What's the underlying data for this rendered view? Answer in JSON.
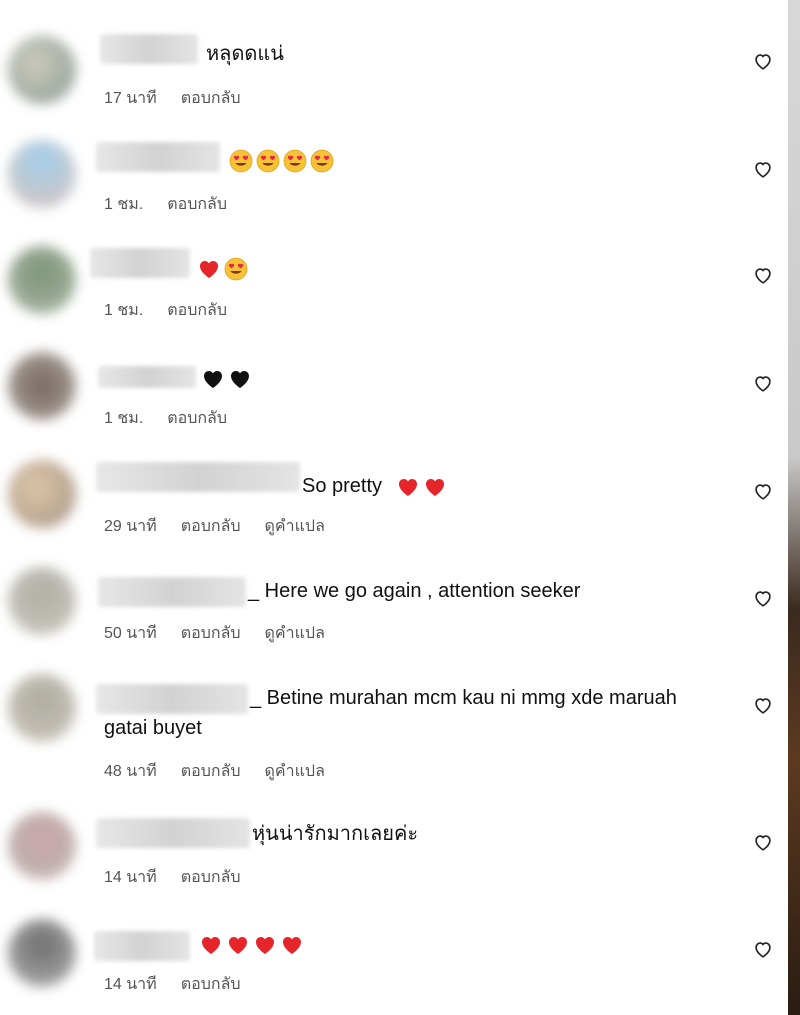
{
  "comments": [
    {
      "text": "หลุดดแน่",
      "time": "17 นาที",
      "reply": "ตอบกลับ",
      "emojis": []
    },
    {
      "text": "",
      "time": "1 ชม.",
      "reply": "ตอบกลับ",
      "emojis": [
        "heart-eyes",
        "heart-eyes",
        "heart-eyes",
        "heart-eyes"
      ]
    },
    {
      "text": "",
      "time": "1 ชม.",
      "reply": "ตอบกลับ",
      "emojis": [
        "red-heart",
        "heart-eyes"
      ]
    },
    {
      "text": "",
      "time": "1 ชม.",
      "reply": "ตอบกลับ",
      "emojis": [
        "black-heart",
        "black-heart"
      ]
    },
    {
      "text": "So pretty",
      "time": "29 นาที",
      "reply": "ตอบกลับ",
      "translate": "ดูคำแปล",
      "emojis": [
        "red-heart",
        "red-heart"
      ]
    },
    {
      "text": "_ Here we go again , attention seeker",
      "time": "50 นาที",
      "reply": "ตอบกลับ",
      "translate": "ดูคำแปล",
      "emojis": []
    },
    {
      "text": "_ Betine murahan mcm kau ni mmg xde maruah",
      "text2": "gatai buyet",
      "time": "48 นาที",
      "reply": "ตอบกลับ",
      "translate": "ดูคำแปล",
      "emojis": []
    },
    {
      "text": "หุ่นน่ารักมากเลยค่ะ",
      "time": "14 นาที",
      "reply": "ตอบกลับ",
      "emojis": []
    },
    {
      "text": "",
      "time": "14 นาที",
      "reply": "ตอบกลับ",
      "emojis": [
        "red-heart",
        "red-heart",
        "red-heart",
        "red-heart"
      ]
    }
  ],
  "icons": {
    "like": "heart-outline-icon"
  },
  "colors": {
    "red_heart": "#e5252a",
    "meta": "#555555"
  }
}
